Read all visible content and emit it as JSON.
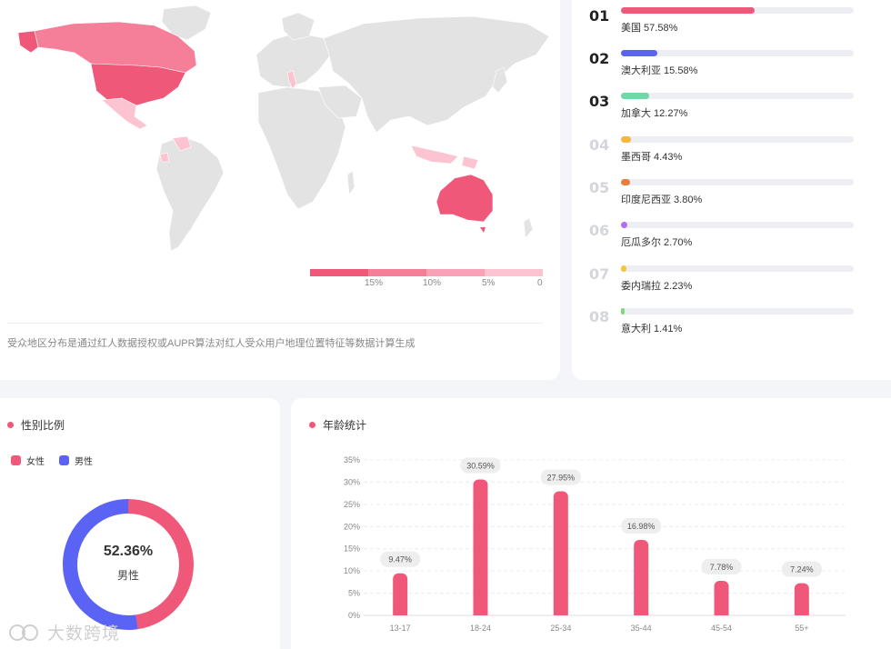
{
  "map": {
    "legend_ticks": [
      "15%",
      "10%",
      "5%",
      "0"
    ],
    "legend_colors": [
      "#f0587a",
      "#f57e99",
      "#f9a2b5",
      "#fcc4d0"
    ],
    "note": "受众地区分布是通过红人数据授权或AUPR算法对红人受众用户地理位置特征等数据计算生成"
  },
  "ranking": {
    "items": [
      {
        "rank": "01",
        "label": "美国 57.58%",
        "value": 57.58,
        "color": "#f0587a",
        "highlight": true
      },
      {
        "rank": "02",
        "label": "澳大利亚 15.58%",
        "value": 15.58,
        "color": "#5b63f4",
        "highlight": true
      },
      {
        "rank": "03",
        "label": "加拿大 12.27%",
        "value": 12.27,
        "color": "#6fd8a6",
        "highlight": true
      },
      {
        "rank": "04",
        "label": "墨西哥 4.43%",
        "value": 4.43,
        "color": "#f5b83a",
        "highlight": false
      },
      {
        "rank": "05",
        "label": "印度尼西亚 3.80%",
        "value": 3.8,
        "color": "#f07a3a",
        "highlight": false
      },
      {
        "rank": "06",
        "label": "厄瓜多尔 2.70%",
        "value": 2.7,
        "color": "#b36ef0",
        "highlight": false
      },
      {
        "rank": "07",
        "label": "委内瑞拉 2.23%",
        "value": 2.23,
        "color": "#f5c53a",
        "highlight": false
      },
      {
        "rank": "08",
        "label": "意大利 1.41%",
        "value": 1.41,
        "color": "#7fd87a",
        "highlight": false
      }
    ]
  },
  "gender": {
    "title": "性别比例",
    "legend": [
      {
        "label": "女性",
        "color": "#f0587a"
      },
      {
        "label": "男性",
        "color": "#5b63f4"
      }
    ],
    "female_pct": 47.64,
    "male_pct": 52.36,
    "center_value": "52.36%",
    "center_label": "男性"
  },
  "age": {
    "title": "年龄统计"
  },
  "chart_data": {
    "type": "bar",
    "categories": [
      "13-17",
      "18-24",
      "25-34",
      "35-44",
      "45-54",
      "55+"
    ],
    "values": [
      9.47,
      30.59,
      27.95,
      16.98,
      7.78,
      7.24
    ],
    "data_labels": [
      "9.47%",
      "30.59%",
      "27.95%",
      "16.98%",
      "7.78%",
      "7.24%"
    ],
    "y_ticks": [
      "0%",
      "5%",
      "10%",
      "15%",
      "20%",
      "25%",
      "30%",
      "35%"
    ],
    "ylim": [
      0,
      35
    ],
    "grid": true,
    "bar_color": "#f0587a",
    "title": "",
    "xlabel": "",
    "ylabel": ""
  },
  "watermark": "大数跨境"
}
